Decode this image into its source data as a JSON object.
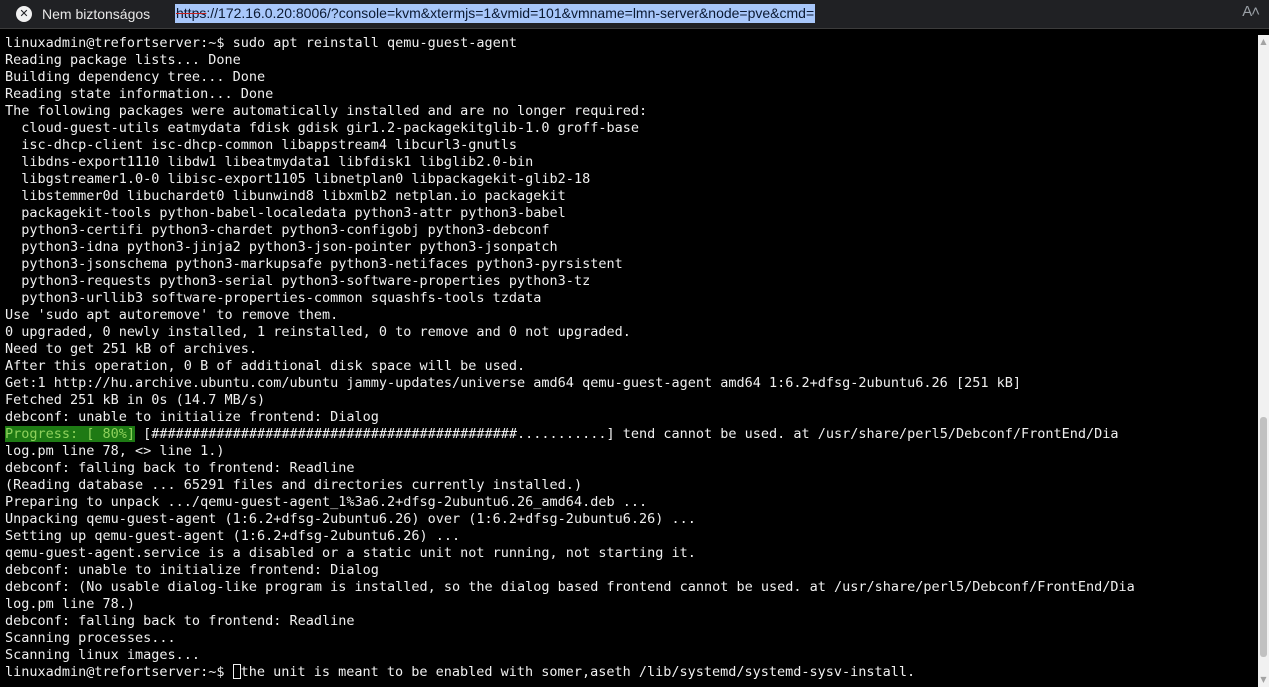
{
  "browser": {
    "security_label": "Nem biztonságos",
    "security_icon": "close-circle-icon",
    "url_scheme": "https",
    "url_rest": "://172.16.0.20:8006/?console=kvm&xtermjs=1&vmid=101&vmname=lmn-server&node=pve&cmd=",
    "read_aloud_glyph": "A˄",
    "selection_color": "#a8c7fa"
  },
  "terminal": {
    "background": "#000000",
    "foreground": "#f0f0f0",
    "progress_bg": "#1e7a14",
    "progress_fg": "#8fd15c",
    "lines": [
      "linuxadmin@trefortserver:~$ sudo apt reinstall qemu-guest-agent",
      "Reading package lists... Done",
      "Building dependency tree... Done",
      "Reading state information... Done",
      "The following packages were automatically installed and are no longer required:",
      "  cloud-guest-utils eatmydata fdisk gdisk gir1.2-packagekitglib-1.0 groff-base",
      "  isc-dhcp-client isc-dhcp-common libappstream4 libcurl3-gnutls",
      "  libdns-export1110 libdw1 libeatmydata1 libfdisk1 libglib2.0-bin",
      "  libgstreamer1.0-0 libisc-export1105 libnetplan0 libpackagekit-glib2-18",
      "  libstemmer0d libuchardet0 libunwind8 libxmlb2 netplan.io packagekit",
      "  packagekit-tools python-babel-localedata python3-attr python3-babel",
      "  python3-certifi python3-chardet python3-configobj python3-debconf",
      "  python3-idna python3-jinja2 python3-json-pointer python3-jsonpatch",
      "  python3-jsonschema python3-markupsafe python3-netifaces python3-pyrsistent",
      "  python3-requests python3-serial python3-software-properties python3-tz",
      "  python3-urllib3 software-properties-common squashfs-tools tzdata",
      "Use 'sudo apt autoremove' to remove them.",
      "0 upgraded, 0 newly installed, 1 reinstalled, 0 to remove and 0 not upgraded.",
      "Need to get 251 kB of archives.",
      "After this operation, 0 B of additional disk space will be used.",
      "Get:1 http://hu.archive.ubuntu.com/ubuntu jammy-updates/universe amd64 qemu-guest-agent amd64 1:6.2+dfsg-2ubuntu6.26 [251 kB]",
      "Fetched 251 kB in 0s (14.7 MB/s)",
      "debconf: unable to initialize frontend: Dialog"
    ],
    "progress_label": "Progress: [ 80%]",
    "progress_tail": " [#############################################...........] tend cannot be used. at /usr/share/perl5/Debconf/FrontEnd/Dia",
    "lines_after": [
      "log.pm line 78, <> line 1.)",
      "debconf: falling back to frontend: Readline",
      "(Reading database ... 65291 files and directories currently installed.)",
      "Preparing to unpack .../qemu-guest-agent_1%3a6.2+dfsg-2ubuntu6.26_amd64.deb ...",
      "Unpacking qemu-guest-agent (1:6.2+dfsg-2ubuntu6.26) over (1:6.2+dfsg-2ubuntu6.26) ...",
      "Setting up qemu-guest-agent (1:6.2+dfsg-2ubuntu6.26) ...",
      "qemu-guest-agent.service is a disabled or a static unit not running, not starting it.",
      "debconf: unable to initialize frontend: Dialog",
      "debconf: (No usable dialog-like program is installed, so the dialog based frontend cannot be used. at /usr/share/perl5/Debconf/FrontEnd/Dia",
      "log.pm line 78.)",
      "debconf: falling back to frontend: Readline",
      "Scanning processes...",
      "Scanning linux images..."
    ],
    "prompt": "linuxadmin@trefortserver:~$ ",
    "prompt_tail": "the unit is meant to be enabled with somer,aseth /lib/systemd/systemd-sysv-install."
  },
  "scrollbar": {
    "up_glyph": "▲",
    "down_glyph": "▼"
  }
}
